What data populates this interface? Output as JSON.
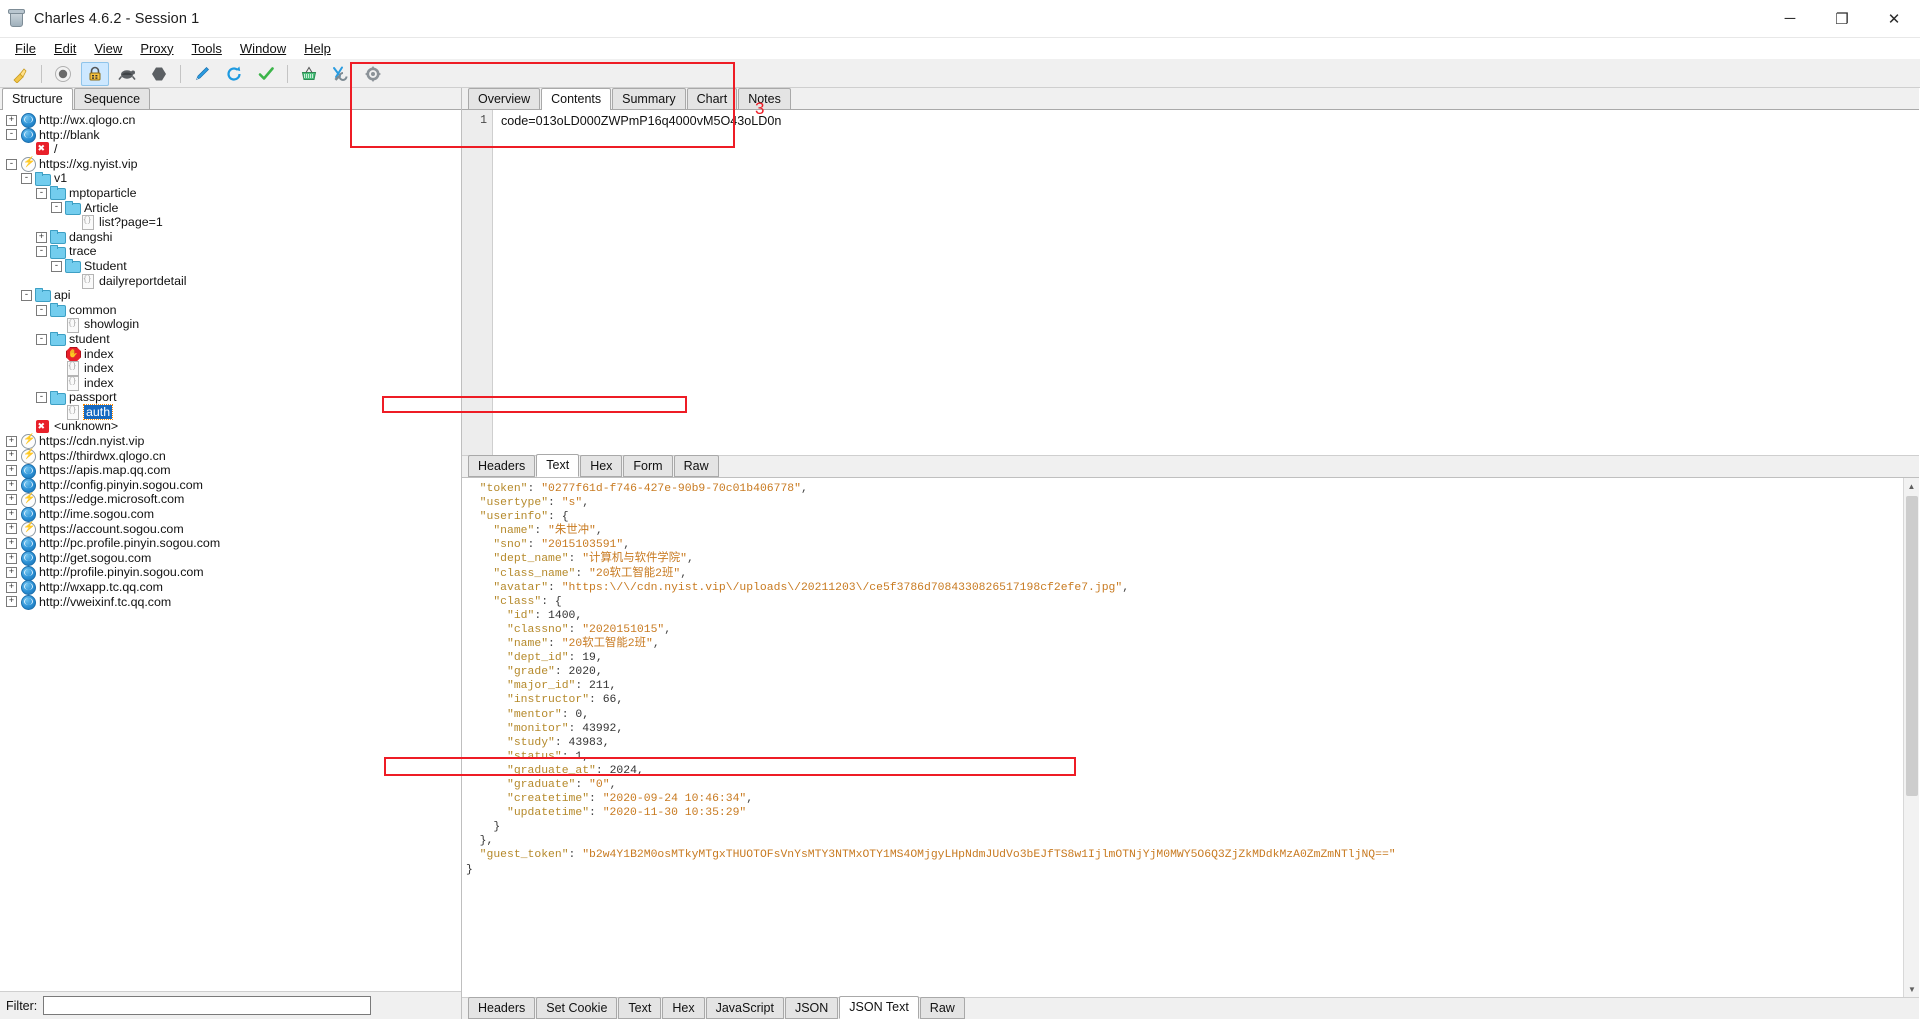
{
  "window": {
    "title": "Charles 4.6.2 - Session 1",
    "app_icon": "charles-jar-icon",
    "minimize": "─",
    "maximize": "❐",
    "close": "✕"
  },
  "menubar": [
    {
      "label": "File",
      "mnemonic": "F"
    },
    {
      "label": "Edit",
      "mnemonic": "E"
    },
    {
      "label": "View",
      "mnemonic": "V"
    },
    {
      "label": "Proxy",
      "mnemonic": "P"
    },
    {
      "label": "Tools",
      "mnemonic": "T"
    },
    {
      "label": "Window",
      "mnemonic": "W"
    },
    {
      "label": "Help",
      "mnemonic": "H"
    }
  ],
  "toolbar": [
    {
      "name": "clear-session-icon",
      "glyph": "🧹",
      "active": false
    },
    {
      "name": "record-icon",
      "glyph": "●",
      "active": false
    },
    {
      "name": "ssl-proxying-icon",
      "glyph": "🔒",
      "active": true
    },
    {
      "name": "throttle-icon",
      "glyph": "🐢",
      "active": false
    },
    {
      "name": "breakpoints-icon",
      "glyph": "⬢",
      "active": false
    },
    {
      "name": "compose-icon",
      "glyph": "✎",
      "active": false
    },
    {
      "name": "repeat-icon",
      "glyph": "⟳",
      "active": false
    },
    {
      "name": "validate-icon",
      "glyph": "✔",
      "active": false
    },
    {
      "name": "tools-basket-icon",
      "glyph": "🧺",
      "active": false
    },
    {
      "name": "tools-icon",
      "glyph": "⚒",
      "active": false
    },
    {
      "name": "settings-icon",
      "glyph": "⚙",
      "active": false
    }
  ],
  "left_panel": {
    "tabs": [
      {
        "label": "Structure",
        "selected": true
      },
      {
        "label": "Sequence",
        "selected": false
      }
    ],
    "tree": [
      {
        "indent": 0,
        "toggle": "+",
        "icon": "globe",
        "label": "http://wx.qlogo.cn",
        "selected": false
      },
      {
        "indent": 0,
        "toggle": "-",
        "icon": "globe",
        "label": "http://blank",
        "selected": false
      },
      {
        "indent": 1,
        "toggle": "",
        "icon": "err",
        "label": "/",
        "selected": false
      },
      {
        "indent": 0,
        "toggle": "-",
        "icon": "bolt",
        "label": "https://xg.nyist.vip",
        "selected": false
      },
      {
        "indent": 1,
        "toggle": "-",
        "icon": "folder",
        "label": "v1",
        "selected": false
      },
      {
        "indent": 2,
        "toggle": "-",
        "icon": "folder",
        "label": "mptoparticle",
        "selected": false
      },
      {
        "indent": 3,
        "toggle": "-",
        "icon": "folder",
        "label": "Article",
        "selected": false
      },
      {
        "indent": 4,
        "toggle": "",
        "icon": "doc",
        "label": "list?page=1",
        "selected": false
      },
      {
        "indent": 2,
        "toggle": "+",
        "icon": "folder",
        "label": "dangshi",
        "selected": false
      },
      {
        "indent": 2,
        "toggle": "-",
        "icon": "folder",
        "label": "trace",
        "selected": false
      },
      {
        "indent": 3,
        "toggle": "-",
        "icon": "folder",
        "label": "Student",
        "selected": false
      },
      {
        "indent": 4,
        "toggle": "",
        "icon": "doc",
        "label": "dailyreportdetail",
        "selected": false
      },
      {
        "indent": 1,
        "toggle": "-",
        "icon": "folder",
        "label": "api",
        "selected": false
      },
      {
        "indent": 2,
        "toggle": "-",
        "icon": "folder",
        "label": "common",
        "selected": false
      },
      {
        "indent": 3,
        "toggle": "",
        "icon": "doc",
        "label": "showlogin",
        "selected": false
      },
      {
        "indent": 2,
        "toggle": "-",
        "icon": "folder",
        "label": "student",
        "selected": false
      },
      {
        "indent": 3,
        "toggle": "",
        "icon": "stop",
        "label": "index",
        "selected": false
      },
      {
        "indent": 3,
        "toggle": "",
        "icon": "doc",
        "label": "index",
        "selected": false
      },
      {
        "indent": 3,
        "toggle": "",
        "icon": "doc",
        "label": "index",
        "selected": false
      },
      {
        "indent": 2,
        "toggle": "-",
        "icon": "folder",
        "label": "passport",
        "selected": false
      },
      {
        "indent": 3,
        "toggle": "",
        "icon": "doc",
        "label": "auth",
        "selected": true
      },
      {
        "indent": 1,
        "toggle": "",
        "icon": "err",
        "label": "<unknown>",
        "selected": false
      },
      {
        "indent": 0,
        "toggle": "+",
        "icon": "bolt",
        "label": "https://cdn.nyist.vip",
        "selected": false
      },
      {
        "indent": 0,
        "toggle": "+",
        "icon": "bolt",
        "label": "https://thirdwx.qlogo.cn",
        "selected": false
      },
      {
        "indent": 0,
        "toggle": "+",
        "icon": "globe",
        "label": "https://apis.map.qq.com",
        "selected": false
      },
      {
        "indent": 0,
        "toggle": "+",
        "icon": "globe",
        "label": "http://config.pinyin.sogou.com",
        "selected": false
      },
      {
        "indent": 0,
        "toggle": "+",
        "icon": "bolt",
        "label": "https://edge.microsoft.com",
        "selected": false
      },
      {
        "indent": 0,
        "toggle": "+",
        "icon": "globe",
        "label": "http://ime.sogou.com",
        "selected": false
      },
      {
        "indent": 0,
        "toggle": "+",
        "icon": "bolt",
        "label": "https://account.sogou.com",
        "selected": false
      },
      {
        "indent": 0,
        "toggle": "+",
        "icon": "globe",
        "label": "http://pc.profile.pinyin.sogou.com",
        "selected": false
      },
      {
        "indent": 0,
        "toggle": "+",
        "icon": "globe",
        "label": "http://get.sogou.com",
        "selected": false
      },
      {
        "indent": 0,
        "toggle": "+",
        "icon": "globe",
        "label": "http://profile.pinyin.sogou.com",
        "selected": false
      },
      {
        "indent": 0,
        "toggle": "+",
        "icon": "globe",
        "label": "http://wxapp.tc.qq.com",
        "selected": false
      },
      {
        "indent": 0,
        "toggle": "+",
        "icon": "globe",
        "label": "http://vweixinf.tc.qq.com",
        "selected": false
      }
    ],
    "filter": {
      "label": "Filter:",
      "value": "",
      "placeholder": ""
    }
  },
  "request_panel": {
    "tabs": [
      {
        "label": "Overview",
        "selected": false
      },
      {
        "label": "Contents",
        "selected": true
      },
      {
        "label": "Summary",
        "selected": false
      },
      {
        "label": "Chart",
        "selected": false
      },
      {
        "label": "Notes",
        "selected": false
      }
    ],
    "line_number": "1",
    "content": "code=013oLD000ZWPmP16q4000vM5O43oLD0n",
    "format_tabs": [
      {
        "label": "Headers",
        "selected": false
      },
      {
        "label": "Text",
        "selected": true
      },
      {
        "label": "Hex",
        "selected": false
      },
      {
        "label": "Form",
        "selected": false
      },
      {
        "label": "Raw",
        "selected": false
      }
    ]
  },
  "response_panel": {
    "json_lines": [
      "  \"token\": \"0277f61d-f746-427e-90b9-70c01b406778\",",
      "  \"usertype\": \"s\",",
      "  \"userinfo\": {",
      "    \"name\": \"朱世冲\",",
      "    \"sno\": \"2015103591\",",
      "    \"dept_name\": \"计算机与软件学院\",",
      "    \"class_name\": \"20软工智能2班\",",
      "    \"avatar\": \"https:\\/\\/cdn.nyist.vip\\/uploads\\/20211203\\/ce5f3786d7084330826517198cf2efe7.jpg\",",
      "    \"class\": {",
      "      \"id\": 1400,",
      "      \"classno\": \"2020151015\",",
      "      \"name\": \"20软工智能2班\",",
      "      \"dept_id\": 19,",
      "      \"grade\": 2020,",
      "      \"major_id\": 211,",
      "      \"instructor\": 66,",
      "      \"mentor\": 0,",
      "      \"monitor\": 43992,",
      "      \"study\": 43983,",
      "      \"status\": 1,",
      "      \"graduate_at\": 2024,",
      "      \"graduate\": \"0\",",
      "      \"createtime\": \"2020-09-24 10:46:34\",",
      "      \"updatetime\": \"2020-11-30 10:35:29\"",
      "    }",
      "  },",
      "  \"guest_token\": \"b2w4Y1B2M0osMTkyMTgxTHUOTOFsVnYsMTY3NTMxOTY1MS4OMjgyLHpNdmJUdVo3bEJfTS8w1IjlmOTNjYjM0MWY5O6Q3ZjZkMDdkMzA0ZmZmNTljNQ==\""
    ],
    "closing_brace": "}",
    "format_tabs": [
      {
        "label": "Headers",
        "selected": false
      },
      {
        "label": "Set Cookie",
        "selected": false
      },
      {
        "label": "Text",
        "selected": false
      },
      {
        "label": "Hex",
        "selected": false
      },
      {
        "label": "JavaScript",
        "selected": false
      },
      {
        "label": "JSON",
        "selected": false
      },
      {
        "label": "JSON Text",
        "selected": true
      },
      {
        "label": "Raw",
        "selected": false
      }
    ],
    "scrollbar": {
      "up": "▲",
      "down": "▼"
    }
  },
  "annotations": {
    "marker_3": "3",
    "color": "#ee1c25"
  }
}
